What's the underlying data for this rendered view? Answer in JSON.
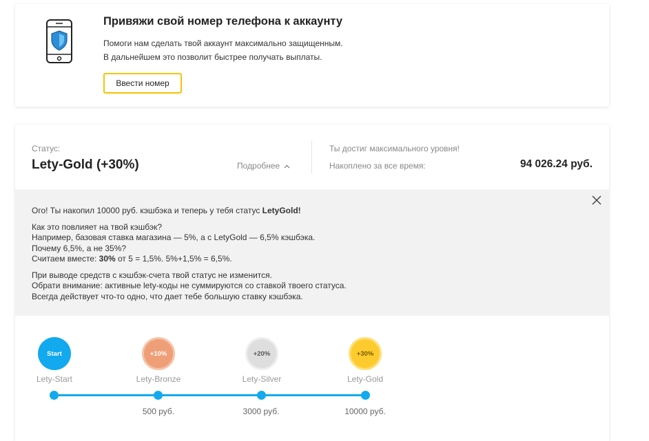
{
  "phone_card": {
    "icon": "phone-shield-icon",
    "title": "Привяжи свой номер телефона к аккаунту",
    "desc_line1": "Помоги нам сделать твой аккаунт максимально защищенным.",
    "desc_line2": "В дальнейшем это позволит быстрее получать выплаты.",
    "button_label": "Ввести номер",
    "accent_color": "#f5c400"
  },
  "status": {
    "label": "Статус:",
    "value": "Lety-Gold (+30%)",
    "more_label": "Подробнее",
    "max_level_text": "Ты достиг максимального уровня!",
    "accumulated_label": "Накоплено за все время:",
    "accumulated_value": "94 026.24 руб."
  },
  "info": {
    "line1_pre": "Ого! Ты накопил 10000 руб. кэшбэка и теперь у тебя статус ",
    "line1_bold": "LetyGold!",
    "line2": "Как это повлияет на твой кэшбэк?",
    "line3": "Например, базовая ставка магазина — 5%, а с LetyGold — 6,5% кэшбэка.",
    "line4": "Почему 6,5%, а не 35%?",
    "line5_pre": "Считаем вместе: ",
    "line5_bold": "30%",
    "line5_post": " от 5 = 1,5%. 5%+1,5% = 6,5%.",
    "line6": "При выводе средств с кэшбэк-счета твой статус не изменится.",
    "line7": "Обрати внимание: активные lety-коды не суммируются со ставкой твоего статуса.",
    "line8": "Всегда действует что-то одно, что дает тебе большую ставку кэшбэка."
  },
  "levels": [
    {
      "badge": "Start",
      "name": "Lety-Start",
      "threshold": "",
      "color": "#12a9ee"
    },
    {
      "badge": "+10%",
      "name": "Lety-Bronze",
      "threshold": "500 руб.",
      "color": "#ee9f77"
    },
    {
      "badge": "+20%",
      "name": "Lety-Silver",
      "threshold": "3000 руб.",
      "color": "#dedede"
    },
    {
      "badge": "+30%",
      "name": "Lety-Gold",
      "threshold": "10000 руб.",
      "color": "#fecb2f"
    }
  ],
  "track_color": "#12a9ee"
}
